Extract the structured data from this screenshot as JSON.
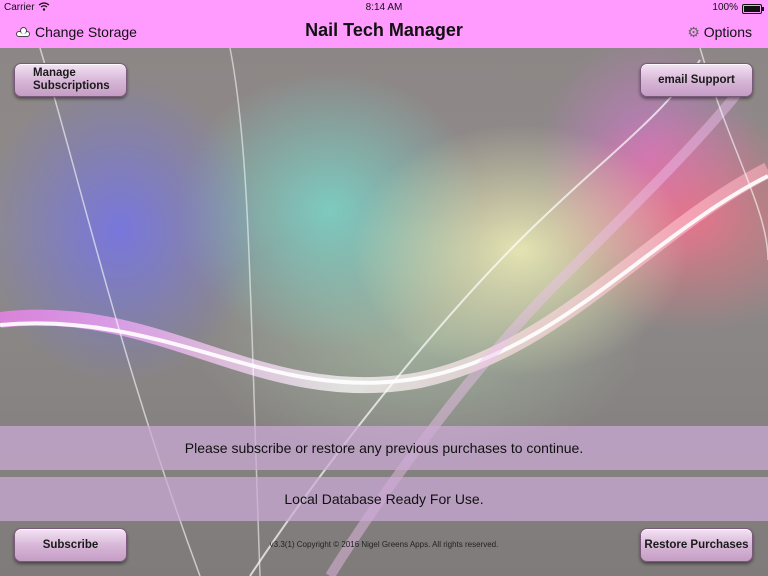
{
  "status_bar": {
    "carrier": "Carrier",
    "time": "8:14 AM",
    "battery": "100%"
  },
  "navbar": {
    "title": "Nail Tech Manager",
    "left_label": "Change Storage",
    "right_label": "Options",
    "accent_color": "#ff9aff"
  },
  "buttons": {
    "manage_subscriptions": "Manage Subscriptions",
    "email_support": "email Support",
    "subscribe": "Subscribe",
    "restore_purchases": "Restore Purchases"
  },
  "messages": {
    "subscribe_prompt": "Please subscribe or restore any previous purchases to continue.",
    "database_status": "Local Database Ready For Use."
  },
  "footer": {
    "copyright": "v3.3(1) Copyright © 2016 Nigel Greens Apps. All rights reserved."
  },
  "icons": {
    "left": "cloud-icon",
    "right": "gear-icon",
    "status": "wifi-icon"
  }
}
